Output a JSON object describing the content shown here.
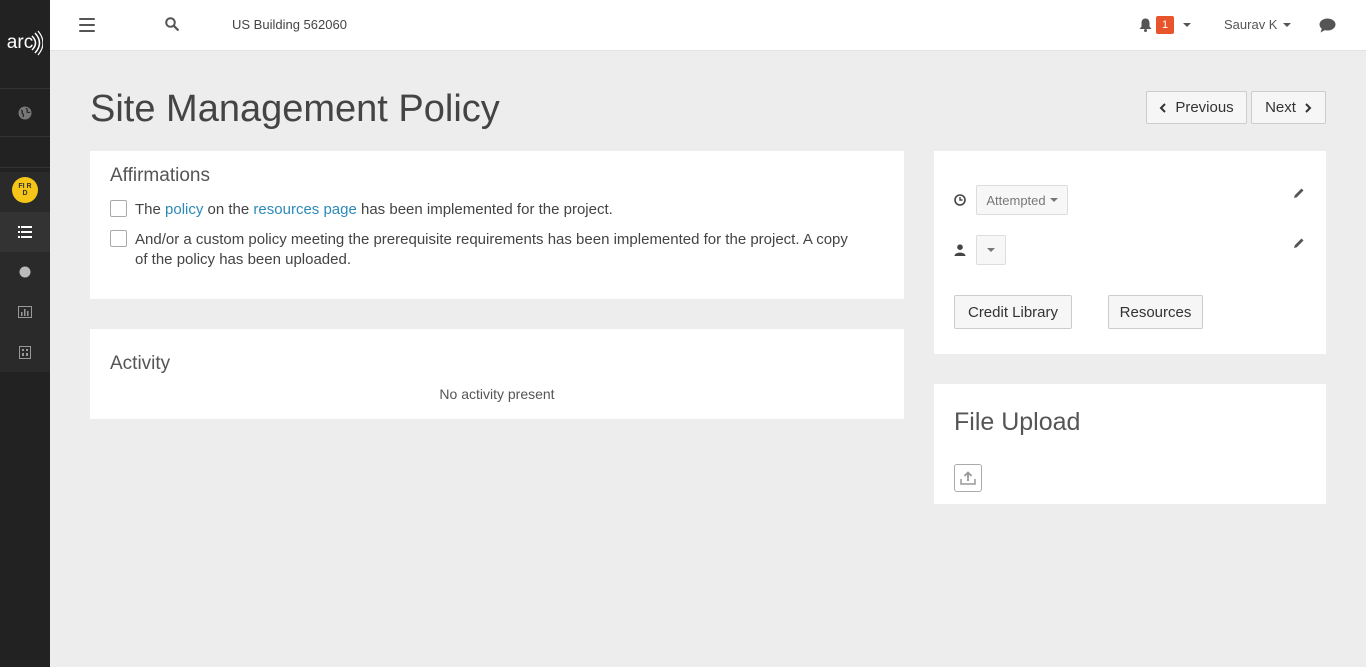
{
  "sidebar": {
    "logo_text": "arc",
    "items": [
      {
        "icon": "globe-icon"
      },
      {
        "icon": "project-badge-icon",
        "badge_text": "FI RD"
      },
      {
        "icon": "list-icon"
      },
      {
        "icon": "circle-icon"
      },
      {
        "icon": "bar-chart-icon"
      },
      {
        "icon": "report-icon"
      }
    ]
  },
  "header": {
    "project_name": "US Building 562060",
    "notification_count": "1",
    "user_name": "Saurav K"
  },
  "page": {
    "title": "Site Management Policy",
    "prev_label": "Previous",
    "next_label": "Next"
  },
  "affirmations": {
    "title": "Affirmations",
    "item1": {
      "pre": "The ",
      "link1": "policy",
      "mid": " on the ",
      "link2": "resources page",
      "post": " has been implemented for the project."
    },
    "item2_line1": "And/or a custom policy meeting the prerequisite requirements has been implemented for the project. A copy",
    "item2_line2": "of the policy has been uploaded."
  },
  "activity": {
    "title": "Activity",
    "empty_text": "No activity present"
  },
  "status": {
    "status_value": "Attempted",
    "credit_library_label": "Credit Library",
    "resources_label": "Resources"
  },
  "upload": {
    "title": "File Upload"
  },
  "colors": {
    "link": "#2b8ab8",
    "notification": "#e8542c",
    "sidebar_bg": "#222222",
    "badge": "#f5c518"
  }
}
